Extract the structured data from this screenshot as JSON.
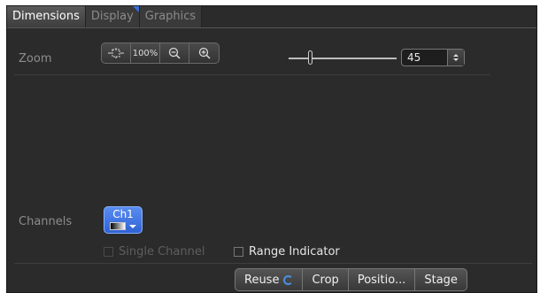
{
  "tabs": [
    {
      "label": "Dimensions",
      "active": true
    },
    {
      "label": "Display",
      "active": false
    },
    {
      "label": "Graphics",
      "active": false
    }
  ],
  "zoom": {
    "label": "Zoom",
    "buttons": [
      {
        "icon": "fit-to-window-icon"
      },
      {
        "icon": "zoom-100-icon",
        "text": "100%"
      },
      {
        "icon": "zoom-out-icon"
      },
      {
        "icon": "zoom-in-icon"
      }
    ],
    "slider_value": 45,
    "value": "45"
  },
  "channels": {
    "label": "Channels",
    "channel_button_label": "Ch1"
  },
  "options": {
    "single_channel": {
      "label": "Single Channel",
      "checked": false,
      "enabled": false
    },
    "range_indicator": {
      "label": "Range Indicator",
      "checked": false,
      "enabled": true
    }
  },
  "actions": {
    "reuse": "Reuse",
    "crop": "Crop",
    "position": "Positio...",
    "stage": "Stage"
  },
  "colors": {
    "panel_bg": "#2b2b2b",
    "accent": "#3b6fd8",
    "channel_button": "#3b6fe0"
  }
}
